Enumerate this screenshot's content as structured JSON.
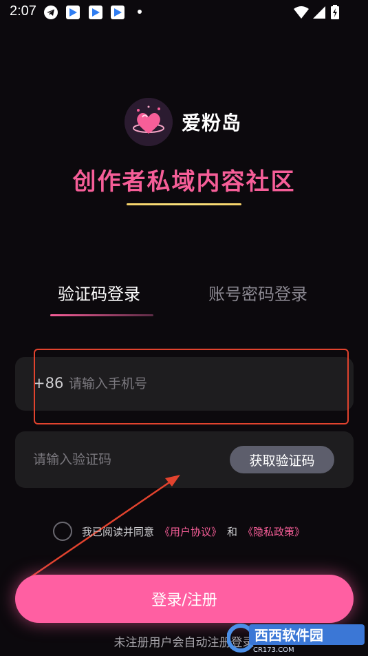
{
  "status_bar": {
    "time": "2:07"
  },
  "app": {
    "name": "爱粉岛",
    "slogan": "创作者私域内容社区"
  },
  "tabs": [
    {
      "label": "验证码登录",
      "active": true
    },
    {
      "label": "账号密码登录",
      "active": false
    }
  ],
  "phone": {
    "prefix": "+86",
    "placeholder": "请输入手机号",
    "value": ""
  },
  "code": {
    "placeholder": "请输入验证码",
    "value": "",
    "button_label": "获取验证码"
  },
  "agreement": {
    "text": "我已阅读并同意",
    "user_agreement": "《用户协议》",
    "and": "和",
    "privacy_policy": "《隐私政策》"
  },
  "login_button": "登录/注册",
  "footer_note": "未注册用户会自动注册登录",
  "watermark": {
    "text": "西西软件园",
    "sub": "CR173.COM"
  },
  "colors": {
    "accent": "#ff5fa2",
    "slogan": "#f65e98",
    "underline_gold": "#f6d36a",
    "annotation": "#e2432e"
  }
}
